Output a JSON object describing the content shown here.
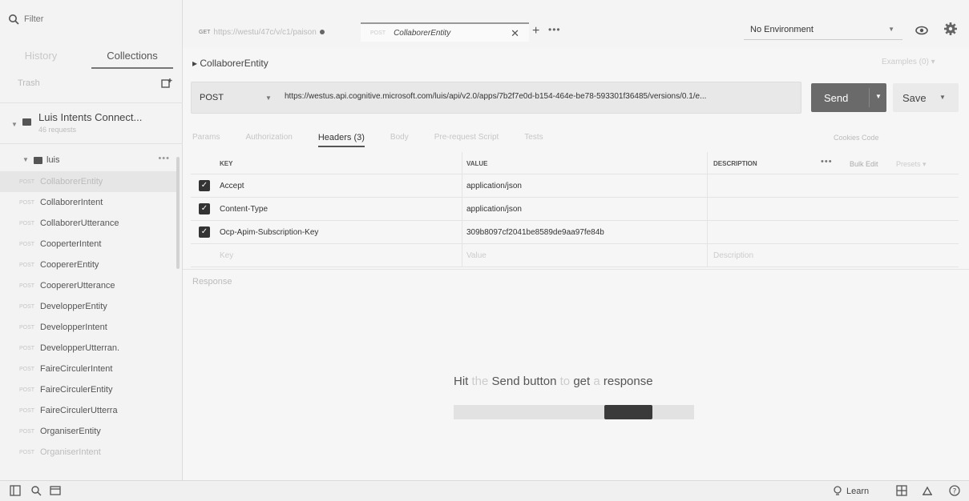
{
  "sidebar": {
    "filter_placeholder": "Filter",
    "tabs": [
      {
        "label": "History"
      },
      {
        "label": "Collections"
      }
    ],
    "trash_label": "Trash",
    "collection": {
      "name": "Luis Intents Connect...",
      "count": "46 requests"
    },
    "folder": {
      "name": "luis"
    },
    "items": [
      {
        "method": "POST",
        "name": "CollaborerEntity"
      },
      {
        "method": "POST",
        "name": "CollaborerIntent"
      },
      {
        "method": "POST",
        "name": "CollaborerUtterance"
      },
      {
        "method": "POST",
        "name": "CooperterIntent"
      },
      {
        "method": "POST",
        "name": "CoopererEntity"
      },
      {
        "method": "POST",
        "name": "CoopererUtterance"
      },
      {
        "method": "POST",
        "name": "DevelopperEntity"
      },
      {
        "method": "POST",
        "name": "DevelopperIntent"
      },
      {
        "method": "POST",
        "name": "DevelopperUtterran."
      },
      {
        "method": "POST",
        "name": "FaireCirculerIntent"
      },
      {
        "method": "POST",
        "name": "FaireCirculerEntity"
      },
      {
        "method": "POST",
        "name": "FaireCirculerUtterra"
      },
      {
        "method": "POST",
        "name": "OrganiserEntity"
      },
      {
        "method": "POST",
        "name": "OrganiserIntent"
      }
    ]
  },
  "tabs": {
    "tab1": {
      "method": "GET",
      "label": "https://westu/47c/v/c1/paison"
    },
    "tab2": {
      "method": "POST",
      "label": "CollaborerEntity"
    }
  },
  "environment": {
    "label": "No Environment"
  },
  "request": {
    "title": "CollaborerEntity",
    "examples": "Examples (0)",
    "method": "POST",
    "url": "https://westus.api.cognitive.microsoft.com/luis/api/v2.0/apps/7b2f7e0d-b154-464e-be78-593301f36485/versions/0.1/e...",
    "send_label": "Send",
    "save_label": "Save"
  },
  "subtabs": [
    {
      "label": "Params"
    },
    {
      "label": "Authorization"
    },
    {
      "label": "Headers (3)"
    },
    {
      "label": "Body"
    },
    {
      "label": "Pre-request Script"
    },
    {
      "label": "Tests"
    }
  ],
  "cookies_code": "Cookies  Code",
  "headers_table": {
    "columns": {
      "key": "KEY",
      "value": "VALUE",
      "description": "DESCRIPTION"
    },
    "bulk_edit": "Bulk Edit",
    "presets": "Presets",
    "rows": [
      {
        "key": "Accept",
        "value": "application/json",
        "description": ""
      },
      {
        "key": "Content-Type",
        "value": "application/json",
        "description": ""
      },
      {
        "key": "Ocp-Apim-Subscription-Key",
        "value": "309b8097cf2041be8589de9aa97fe84b",
        "description": ""
      }
    ],
    "new_row": {
      "key": "Key",
      "value": "Value",
      "description": "Description"
    }
  },
  "response": {
    "label": "Response",
    "hint_parts": [
      "Hit",
      "the",
      "Send button",
      "to",
      "get",
      "a",
      "response"
    ]
  },
  "statusbar": {
    "learn_label": "Learn"
  }
}
